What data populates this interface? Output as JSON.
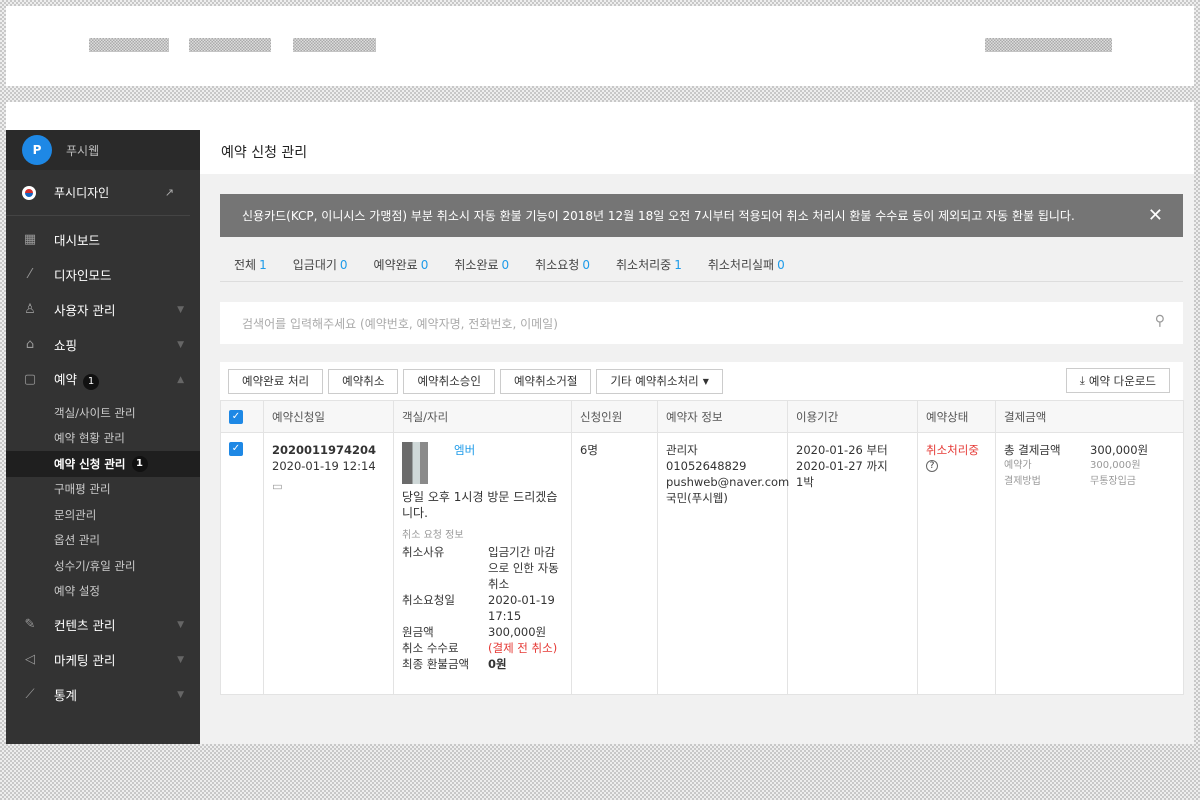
{
  "sidebar": {
    "brand": {
      "logo": "P",
      "name": "푸시웹"
    },
    "site": {
      "name": "푸시디자인",
      "external_icon": "external-link-icon"
    },
    "items": [
      {
        "label": "대시보드",
        "icon": "grid-icon"
      },
      {
        "label": "디자인모드",
        "icon": "wand-icon"
      },
      {
        "label": "사용자 관리",
        "icon": "user-icon"
      },
      {
        "label": "쇼핑",
        "icon": "bag-icon"
      },
      {
        "label": "예약",
        "icon": "calendar-icon",
        "badge": "1"
      },
      {
        "label": "컨텐츠 관리",
        "icon": "edit-icon"
      },
      {
        "label": "마케팅 관리",
        "icon": "megaphone-icon"
      },
      {
        "label": "통계",
        "icon": "chart-icon"
      }
    ],
    "sub": [
      "객실/사이트 관리",
      "예약 현황 관리",
      "예약 신청 관리",
      "구매평 관리",
      "문의관리",
      "옵션 관리",
      "성수기/휴일 관리",
      "예약 설정"
    ],
    "sub_badge": "1"
  },
  "page": {
    "title": "예약 신청 관리"
  },
  "notice": {
    "text": "신용카드(KCP, 이니시스 가맹점) 부분 취소시 자동 환불 기능이 2018년 12월 18일 오전 7시부터 적용되어 취소 처리시 환불 수수료 등이 제외되고 자동 환불 됩니다.",
    "close": "✕"
  },
  "tabs": [
    {
      "label": "전체",
      "count": "1"
    },
    {
      "label": "입금대기",
      "count": "0"
    },
    {
      "label": "예약완료",
      "count": "0"
    },
    {
      "label": "취소완료",
      "count": "0"
    },
    {
      "label": "취소요청",
      "count": "0"
    },
    {
      "label": "취소처리중",
      "count": "1"
    },
    {
      "label": "취소처리실패",
      "count": "0"
    }
  ],
  "search": {
    "placeholder": "검색어를 입력해주세요 (예약번호, 예약자명, 전화번호, 이메일)"
  },
  "toolbar": {
    "buttons": [
      "예약완료 처리",
      "예약취소",
      "예약취소승인",
      "예약취소거절",
      "기타 예약취소처리"
    ],
    "download": "예약 다운로드"
  },
  "table": {
    "headers": [
      "예약신청일",
      "객실/자리",
      "신청인원",
      "예약자 정보",
      "이용기간",
      "예약상태",
      "결제금액"
    ],
    "row": {
      "order_no": "2020011974204",
      "order_date": "2020-01-19 12:14",
      "room_name": "엠버",
      "memo": "당일 오후 1시경 방문 드리겠습니다.",
      "cancel_title": "취소 요청 정보",
      "cancel": {
        "reason_label": "취소사유",
        "reason": "입금기간 마감으로 인한 자동 취소",
        "date_label": "취소요청일",
        "date": "2020-01-19 17:15",
        "amount_label": "원금액",
        "amount": "300,000원",
        "fee_label": "취소 수수료",
        "fee": "(결제 전 취소)",
        "refund_label": "최종 환불금액",
        "refund": "0원"
      },
      "people": "6명",
      "booker": {
        "name": "관리자",
        "phone": "01052648829",
        "email": "pushweb@naver.com",
        "group": "국민(푸시웹)"
      },
      "period": {
        "start": "2020-01-26 부터",
        "end": "2020-01-27 까지",
        "nights": "1박"
      },
      "status": "취소처리중",
      "payment": {
        "total_label": "총 결제금액",
        "total": "300,000원",
        "price_label": "예약가",
        "price": "300,000원",
        "method_label": "결제방법",
        "method": "무통장입금"
      }
    }
  }
}
